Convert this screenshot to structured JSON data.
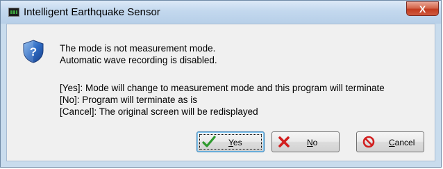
{
  "window": {
    "title": "Intelligent Earthquake Sensor",
    "close_glyph": "X",
    "app_icon": "terminal-icon"
  },
  "dialog": {
    "icon": "question-shield-icon",
    "message_line1": "The mode is not measurement mode.",
    "message_line2": "Automatic wave recording is disabled.",
    "option_yes": "[Yes]: Mode will change to measurement mode and this program will terminate",
    "option_no": "[No]: Program will terminate as is",
    "option_cancel": "[Cancel]: The original screen will be redisplayed"
  },
  "buttons": {
    "yes": {
      "mnemonic": "Y",
      "rest": "es",
      "icon": "check-icon",
      "icon_color": "#2e9a2e"
    },
    "no": {
      "mnemonic": "N",
      "rest": "o",
      "icon": "x-icon",
      "icon_color": "#d21f1f"
    },
    "cancel": {
      "mnemonic": "C",
      "rest": "ancel",
      "icon": "prohibited-icon",
      "icon_color": "#d21f1f"
    }
  }
}
